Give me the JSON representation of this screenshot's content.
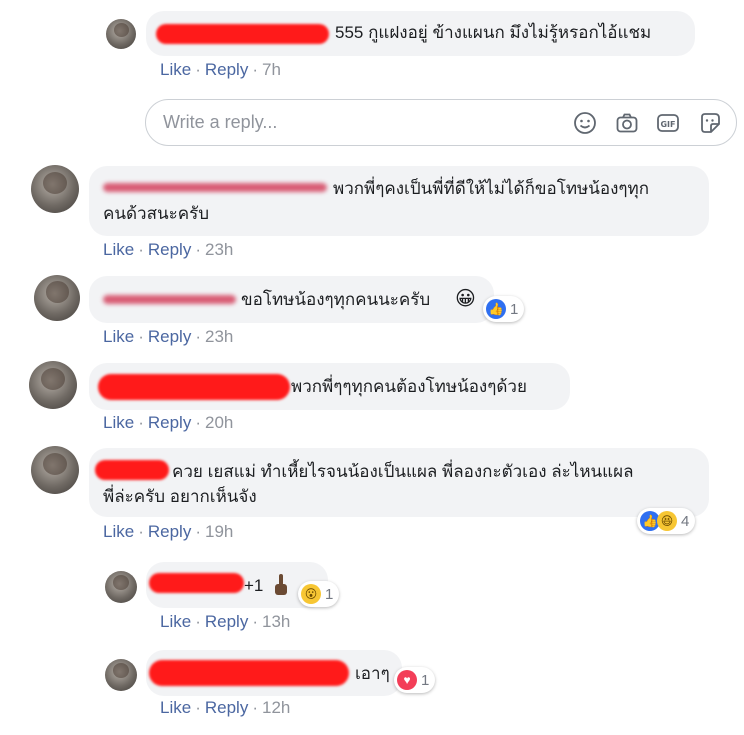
{
  "comments": [
    {
      "text": "555 กูแฝงอยู่ ข้างแผนก มึงไม่รู้หรอกไอ้แชม",
      "like_label": "Like",
      "reply_label": "Reply",
      "time": "7h"
    },
    {
      "text_line1": "พวกพี่ๆคงเป็นพี่ที่ดีให้ไม่ได้ก็ขอโทษน้องๆทุก",
      "text_line2": "คนด้วสนะครับ",
      "like_label": "Like",
      "reply_label": "Reply",
      "time": "23h"
    },
    {
      "text": "ขอโทษน้องๆทุกคนนะครับ",
      "emoji": "😀",
      "reaction_count": "1",
      "like_label": "Like",
      "reply_label": "Reply",
      "time": "23h"
    },
    {
      "text": "พวกพี่ๆๆทุกคนต้องโทษน้องๆด้วย",
      "like_label": "Like",
      "reply_label": "Reply",
      "time": "20h"
    },
    {
      "text_line1": "ควย เยสแม่ ทำเหี้ยไรจนน้องเป็นแผล พี่ลองกะตัวเอง ล่ะไหนแผล",
      "text_line2": "พี่ล่ะครับ อยากเห็นจัง",
      "reaction_count": "4",
      "like_label": "Like",
      "reply_label": "Reply",
      "time": "19h"
    },
    {
      "text": "+1",
      "reaction_count": "1",
      "like_label": "Like",
      "reply_label": "Reply",
      "time": "13h"
    },
    {
      "text": "เอาๆ",
      "reaction_count": "1",
      "like_label": "Like",
      "reply_label": "Reply",
      "time": "12h"
    }
  ],
  "reply_box": {
    "placeholder": "Write a reply..."
  },
  "icons": [
    "smiley-icon",
    "camera-icon",
    "gif-icon",
    "sticker-icon",
    "like-reaction-icon",
    "haha-reaction-icon",
    "wow-reaction-icon",
    "love-reaction-icon",
    "middle-finger-emoji"
  ]
}
